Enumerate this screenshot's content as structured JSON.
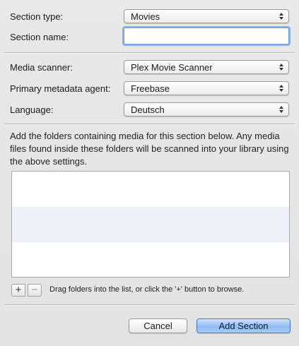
{
  "form": {
    "section_type_label": "Section type:",
    "section_type_value": "Movies",
    "section_name_label": "Section name:",
    "section_name_value": "",
    "media_scanner_label": "Media scanner:",
    "media_scanner_value": "Plex Movie Scanner",
    "metadata_agent_label": "Primary metadata agent:",
    "metadata_agent_value": "Freebase",
    "language_label": "Language:",
    "language_value": "Deutsch"
  },
  "folders": {
    "description": "Add the folders containing media for this section below. Any media files found inside these folders will be scanned into your library using the above settings.",
    "items": [],
    "add_symbol": "+",
    "remove_symbol": "−",
    "hint": "Drag folders into the list, or click the '+' button to browse."
  },
  "buttons": {
    "cancel": "Cancel",
    "add_section": "Add Section"
  },
  "colors": {
    "accent": "#8fbcf3",
    "focus_ring": "#8ab3ea"
  }
}
